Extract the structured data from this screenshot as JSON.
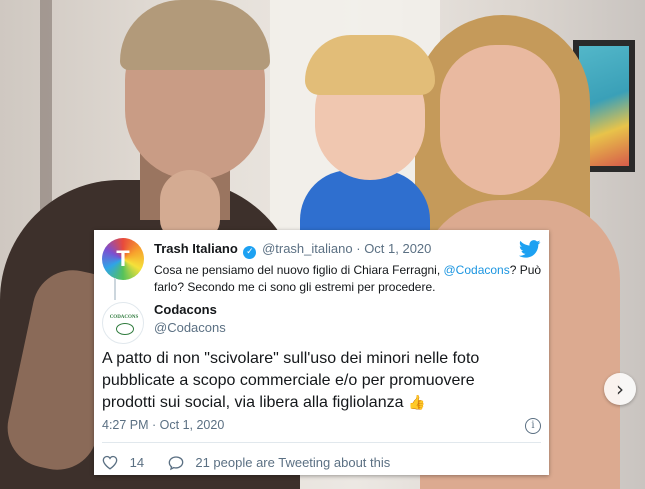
{
  "original_tweet": {
    "display_name": "Trash Italiano",
    "handle": "@trash_italiano",
    "separator": "·",
    "date": "Oct 1, 2020",
    "text_before_mention": "Cosa ne pensiamo del nuovo figlio di Chiara Ferragni, ",
    "mention": "@Codacons",
    "text_after_mention": "? Può farlo? Secondo me ci sono gli estremi per procedere.",
    "avatar_letter": "T"
  },
  "reply_tweet": {
    "display_name": "Codacons",
    "handle": "@Codacons",
    "avatar_text": "CODACONS",
    "text": "A patto di non \"scivolare\" sull'uso dei minori nelle foto pubblicate a scopo commerciale e/o per promuovere prodotti sui social, via libera alla figliolanza",
    "emoji": "👍",
    "timestamp": "4:27 PM · Oct 1, 2020",
    "likes": "14",
    "replies_text": "21 people are Tweeting about this"
  },
  "icons": {
    "verified": "verified-badge-icon",
    "bird": "twitter-bird-icon",
    "info": "info-icon",
    "heart": "heart-icon",
    "reply": "reply-icon",
    "next": "chevron-right-icon"
  },
  "colors": {
    "twitter_blue": "#1da1f2",
    "link": "#1b95e0",
    "muted": "#5b7083",
    "text": "#14171a"
  },
  "carousel": {
    "next_glyph": "›"
  }
}
